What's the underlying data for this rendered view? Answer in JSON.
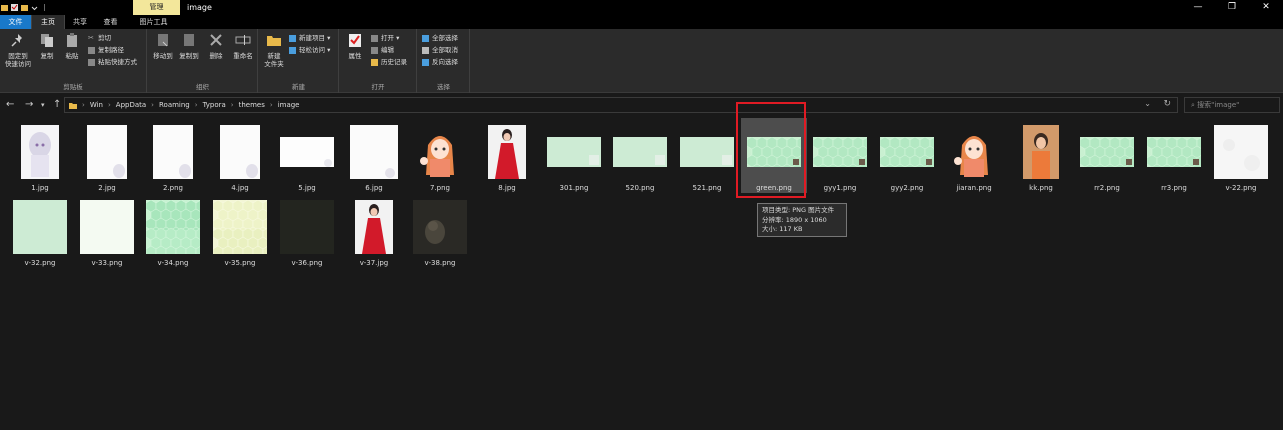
{
  "titlebar": {
    "manage_tab": "管理",
    "title": "image",
    "controls": [
      "—",
      "❐",
      "✕"
    ]
  },
  "tabs": [
    "文件",
    "主页",
    "共享",
    "查看",
    "图片工具"
  ],
  "ribbon": {
    "clipboard": {
      "pin": "固定到\n快速访问",
      "copy": "复制",
      "paste": "粘贴",
      "cut": "剪切",
      "copy_path": "复制路径",
      "paste_shortcut": "粘贴快捷方式",
      "label": "剪贴板"
    },
    "organize": {
      "move_to": "移动到",
      "copy_to": "复制到",
      "delete": "删除",
      "rename": "重命名",
      "label": "组织"
    },
    "new": {
      "new_folder": "新建\n文件夹",
      "new_item": "新建项目 ▾",
      "easy_access": "轻松访问 ▾",
      "label": "新建"
    },
    "open": {
      "properties": "属性",
      "open": "打开 ▾",
      "edit": "编辑",
      "history": "历史记录",
      "label": "打开"
    },
    "select": {
      "select_all": "全部选择",
      "select_none": "全部取消",
      "invert": "反向选择",
      "label": "选择"
    }
  },
  "address": {
    "back": "←",
    "forward": "→",
    "recent": "▾",
    "up": "↑",
    "crumbs": [
      "Win",
      "AppData",
      "Roaming",
      "Typora",
      "themes",
      "image"
    ],
    "dropdown": "⌄",
    "refresh": "↻",
    "search_placeholder": "⌕  搜索\"image\""
  },
  "files": [
    {
      "name": "1.jpg",
      "kind": "anime-white"
    },
    {
      "name": "2.jpg",
      "kind": "white-corner"
    },
    {
      "name": "2.png",
      "kind": "white-corner"
    },
    {
      "name": "4.jpg",
      "kind": "white-corner"
    },
    {
      "name": "5.jpg",
      "kind": "white-wide"
    },
    {
      "name": "6.jpg",
      "kind": "white-tall"
    },
    {
      "name": "7.png",
      "kind": "anime-girl"
    },
    {
      "name": "8.jpg",
      "kind": "red-dress"
    },
    {
      "name": "301.png",
      "kind": "green-wide"
    },
    {
      "name": "520.png",
      "kind": "green-wide"
    },
    {
      "name": "521.png",
      "kind": "green-wide"
    },
    {
      "name": "green.png",
      "kind": "green-pattern",
      "selected": true
    },
    {
      "name": "gyy1.png",
      "kind": "green-pattern"
    },
    {
      "name": "gyy2.png",
      "kind": "green-pattern"
    },
    {
      "name": "jiaran.png",
      "kind": "anime-girl"
    },
    {
      "name": "kk.png",
      "kind": "orange-girl"
    },
    {
      "name": "rr2.png",
      "kind": "green-pattern"
    },
    {
      "name": "rr3.png",
      "kind": "green-pattern"
    },
    {
      "name": "v-22.png",
      "kind": "light-gray"
    },
    {
      "name": "v-32.png",
      "kind": "green-square"
    },
    {
      "name": "v-33.png",
      "kind": "white-green"
    },
    {
      "name": "v-34.png",
      "kind": "green-hex"
    },
    {
      "name": "v-35.png",
      "kind": "yellow-hex"
    },
    {
      "name": "v-36.png",
      "kind": "dark"
    },
    {
      "name": "v-37.jpg",
      "kind": "red-dress"
    },
    {
      "name": "v-38.png",
      "kind": "dark-cat"
    }
  ],
  "tooltip": {
    "line1": "项目类型: PNG 图片文件",
    "line2": "分辨率: 1890 x 1060",
    "line3": "大小: 117 KB"
  }
}
